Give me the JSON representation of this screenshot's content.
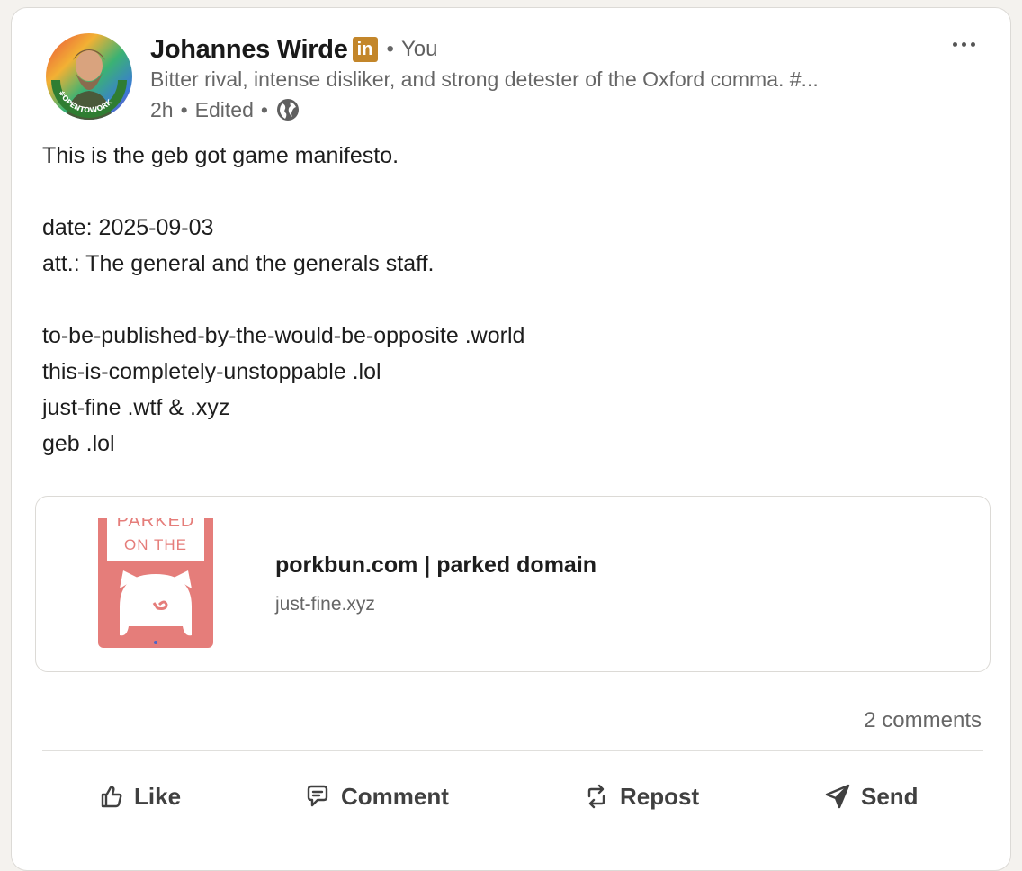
{
  "post": {
    "author": {
      "name": "Johannes Wirde",
      "badge": "in",
      "separator": "•",
      "degree": "You",
      "headline": "Bitter rival, intense disliker, and strong detester of the Oxford comma. #...",
      "avatar_ring_text": "#OPENTOWORK"
    },
    "meta": {
      "time": "2h",
      "edited": "Edited",
      "separator": "•",
      "visibility_icon": "globe-icon"
    },
    "more_icon": "more-horizontal-icon",
    "body_lines": [
      "This is the geb got game manifesto.",
      "",
      "date: 2025-09-03",
      "att.: The general and the generals staff.",
      "",
      "to-be-published-by-the-would-be-opposite .world",
      "this-is-completely-unstoppable .lol",
      "just-fine .wtf & .xyz",
      "geb .lol"
    ],
    "link_preview": {
      "thumb_text_1": "PARKED",
      "thumb_text_2": "ON THE",
      "title": "porkbun.com | parked domain",
      "domain": "just-fine.xyz"
    },
    "social": {
      "comments": "2 comments"
    },
    "actions": [
      {
        "label": "Like",
        "icon": "like-icon"
      },
      {
        "label": "Comment",
        "icon": "comment-icon"
      },
      {
        "label": "Repost",
        "icon": "repost-icon"
      },
      {
        "label": "Send",
        "icon": "send-icon"
      }
    ]
  },
  "colors": {
    "badge": "#c3862a",
    "thumb": "#e57d7a",
    "text_primary": "#1d1d1d",
    "text_secondary": "#666666"
  }
}
